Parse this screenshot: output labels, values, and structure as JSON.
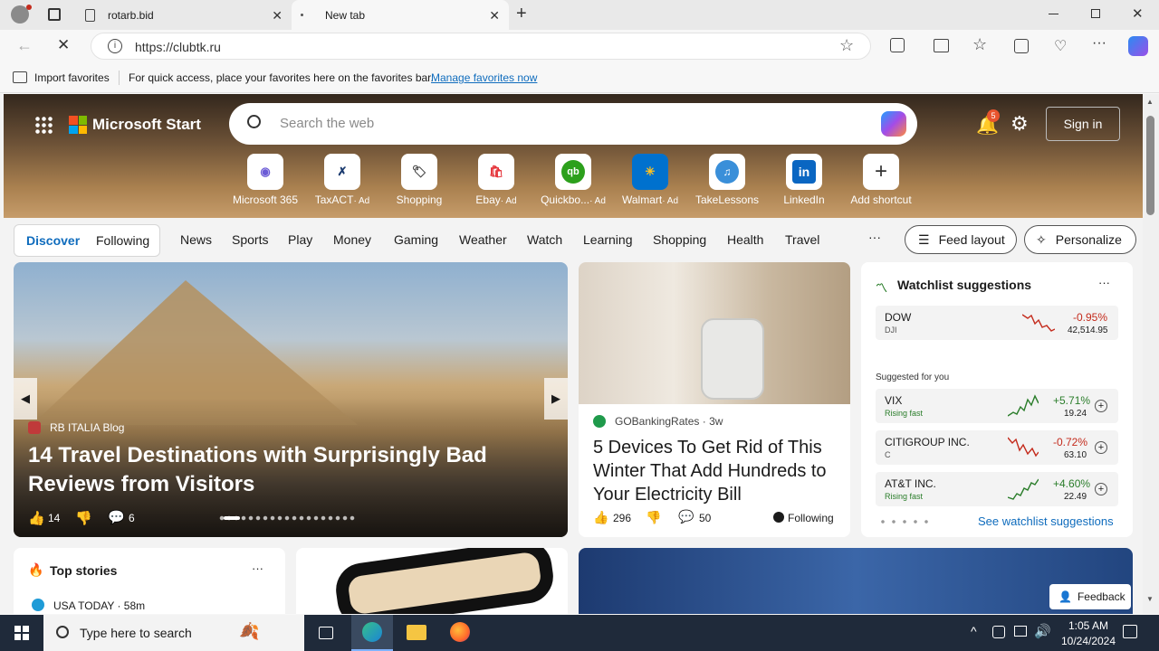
{
  "tabs": [
    {
      "label": "rotarb.bid"
    },
    {
      "label": "New tab"
    }
  ],
  "address": {
    "url": "https://clubtk.ru"
  },
  "favbar": {
    "import_label": "Import favorites",
    "message": "For quick access, place your favorites here on the favorites bar.",
    "manage_link": "Manage favorites now"
  },
  "header": {
    "brand": "Microsoft Start",
    "search_placeholder": "Search the web",
    "notif_count": "5",
    "signin": "Sign in"
  },
  "shortcuts": [
    {
      "label": "Microsoft 365",
      "ad": ""
    },
    {
      "label": "TaxACT",
      "ad": "· Ad"
    },
    {
      "label": "Shopping",
      "ad": ""
    },
    {
      "label": "Ebay",
      "ad": "· Ad"
    },
    {
      "label": "Quickbo...",
      "ad": "· Ad"
    },
    {
      "label": "Walmart",
      "ad": "· Ad"
    },
    {
      "label": "TakeLessons",
      "ad": ""
    },
    {
      "label": "LinkedIn",
      "ad": ""
    },
    {
      "label": "Add shortcut",
      "ad": ""
    }
  ],
  "nav": {
    "discover": "Discover",
    "following": "Following",
    "items": [
      "News",
      "Sports",
      "Play",
      "Money",
      "Gaming",
      "Weather",
      "Watch",
      "Learning",
      "Shopping",
      "Health",
      "Travel"
    ],
    "more": "···",
    "feed_layout": "Feed layout",
    "personalize": "Personalize"
  },
  "hero_story": {
    "source": "RB ITALIA Blog",
    "title": "14 Travel Destinations with Surprisingly Bad Reviews from Visitors",
    "likes": "14",
    "comments": "6"
  },
  "story2": {
    "source": "GOBankingRates",
    "age": "· 3w",
    "title": "5 Devices To Get Rid of This Winter That Add Hundreds to Your Electricity Bill",
    "likes": "296",
    "comments": "50",
    "following": "Following"
  },
  "watchlist": {
    "title": "Watchlist suggestions",
    "more": "···",
    "suggested": "Suggested for you",
    "see_all": "See watchlist suggestions",
    "main": {
      "name": "DOW",
      "ticker": "DJI",
      "change": "-0.95%",
      "price": "42,514.95"
    },
    "stocks": [
      {
        "name": "VIX",
        "sub": "Rising fast",
        "change": "+5.71%",
        "price": "19.24",
        "up": true
      },
      {
        "name": "CITIGROUP INC.",
        "sub": "C",
        "change": "-0.72%",
        "price": "63.10",
        "up": false
      },
      {
        "name": "AT&T INC.",
        "sub": "Rising fast",
        "change": "+4.60%",
        "price": "22.49",
        "up": true
      }
    ]
  },
  "top_stories": {
    "title": "Top stories",
    "more": "···",
    "source": "USA TODAY · 58m"
  },
  "feedback": "Feedback",
  "taskbar": {
    "search": "Type here to search",
    "time": "1:05 AM",
    "date": "10/24/2024"
  },
  "colors": {
    "accent": "#0f6cbd",
    "up": "#2a7d2a",
    "down": "#c42b1c"
  }
}
